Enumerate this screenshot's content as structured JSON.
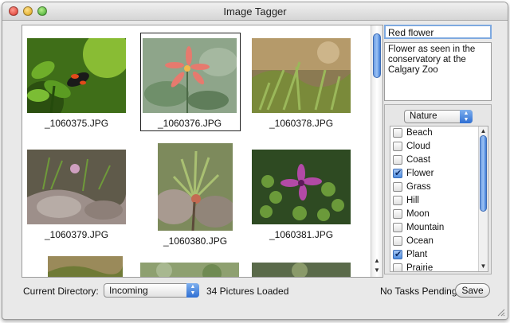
{
  "window": {
    "title": "Image Tagger"
  },
  "photos": [
    {
      "filename": "_1060375.JPG",
      "selected": false
    },
    {
      "filename": "_1060376.JPG",
      "selected": true
    },
    {
      "filename": "_1060378.JPG",
      "selected": false
    },
    {
      "filename": "_1060379.JPG",
      "selected": false
    },
    {
      "filename": "_1060380.JPG",
      "selected": false
    },
    {
      "filename": "_1060381.JPG",
      "selected": false
    }
  ],
  "details": {
    "name": "Red flower",
    "description": "Flower as seen in the conservatory at the Calgary Zoo"
  },
  "tags": {
    "category": "Nature",
    "items": [
      {
        "label": "Beach",
        "checked": false
      },
      {
        "label": "Cloud",
        "checked": false
      },
      {
        "label": "Coast",
        "checked": false
      },
      {
        "label": "Flower",
        "checked": true
      },
      {
        "label": "Grass",
        "checked": false
      },
      {
        "label": "Hill",
        "checked": false
      },
      {
        "label": "Moon",
        "checked": false
      },
      {
        "label": "Mountain",
        "checked": false
      },
      {
        "label": "Ocean",
        "checked": false
      },
      {
        "label": "Plant",
        "checked": true
      },
      {
        "label": "Prairie",
        "checked": false
      }
    ]
  },
  "bottom": {
    "directory_label": "Current Directory:",
    "directory_value": "Incoming",
    "loaded_status": "34 Pictures Loaded",
    "task_status": "No Tasks Pending",
    "save_label": "Save"
  }
}
